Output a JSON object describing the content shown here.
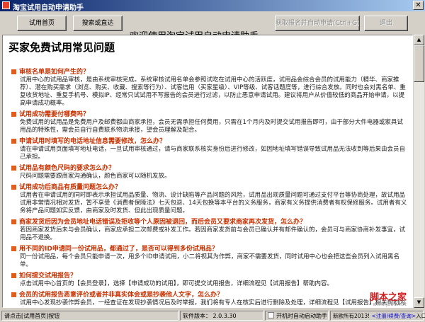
{
  "window": {
    "title": "淘宝试用自动申请助手"
  },
  "toolbar": {
    "home_label": "试用首页",
    "search_label": "搜索或直达",
    "welcome_text": "欢迎使用淘宝试用自动申请助手...",
    "fetch_label": "获取报名并自动申请(Ctrl+G)",
    "exit_label": "退出"
  },
  "content": {
    "title": "买家免费试用常见问题",
    "faq": [
      {
        "q": "审核名单是如何产生的？",
        "a": "试用中心的试用品审核，是由系统审核完成。系统审核试用名单会参照试吃在试用中心的活跃度，试用品会综合会员的试用能力（精华、商家推荐）、潜在购买需求（浏览、购买、收藏、搜索等行为）、试客信用（买家星级）、VIP等级、试客话题度等，进行综合发放。同时也会对黑名单、重复收货地址、重复手机号、模拟IP、经常只试试用不写报告的会员进行过滤，以防止恶意申请试用。建议将用户从价值较低的商品开始申请，以提高申请成功概率。"
      },
      {
        "q": "试用成功需要付哪费吗？",
        "a": "免费试用的试用品是免费用户及邮费都由商家承担，会员无需承担任何费用，只需在1个月内及时提交试用报告即可，由于部分大件电器或家具试用品的特殊性，需会员自行自费联系物流承接，望会员理解及配合。"
      },
      {
        "q": "申请试用时填写的电话地址信息需要修改，怎么办？",
        "a": "请在申请试用页面填写地址电话，一旦试用审核通过，请与商家联系核实身份后进行修改，如因地址填写错误导致试用品无法收到等后果由会员自己承担。"
      },
      {
        "q": "试用品有颜色尺码的要求怎么办？",
        "a": "尺码问题需要跟商家沟通确认，颜色商家可以随机发放。"
      },
      {
        "q": "试用成功后商品有质量问题怎么办？",
        "a": "试用者在申请试用的同时即表示承担试用品质量、物流、设计缺陷等产品问题的风险，试用品出现质量问题可通过支付平台等协商处理，故试用品试用非常情况相对发货，暂不享受《消费者保障法》七天包退、14天包换等本平台的义务服务，商家有义务提供消费者有权保修服务。试用者有义务将产品问题如实反馈，由商家及时发货、但此出现质量问题。"
      },
      {
        "q": "商家发货后因为会员地址电话错误及拒收等个人原因被退回，而后会员又要求商家再次发货，怎么办？",
        "a": "若因商家发货后未与会员确认，商家应承担二次邮费或补发工作。若因商家发货前与会员已确认并有邮件确认的，会员可与商家协商补发事宜，试用品不退换。"
      },
      {
        "q": "用不同的ID申请同一份试用品，都通过了，是否可以得到多份试用品？",
        "a": "同一份试用品，每个会员只能申请一次，用多个ID申请试用，小二将视其为作弊，商家不需要发货，同时试用中心也会把这些会员列入试用黑名单。"
      },
      {
        "q": "如何提交试用报告？",
        "a": "点击试用中心首页的【会员登录】，选择【申请成功的试用】，即可提交试用报告，详细流程见【试用报告】帮助内容。"
      },
      {
        "q": "会员的试用报告恶意评价或者并非真实体会或是抄袭他人文字，怎么办？",
        "a": "试用中心发现抄袭作弊会员，一经查证在发现抄袭情况后及时举报，我们将有专人在核实后进行删除及处理，详细流程见【试用报告】相关帮助内容。"
      },
      {
        "q": "免费试用成功后，商家拒绝发货，我该如何投诉？",
        "a": "在申请成功后一周内，商家有义务主动联系申请成功试客进行发货，如若您未收到联系，请您先去商家主动沟通申请发货。"
      }
    ],
    "watermark": "脚本之家",
    "watermark_sub": "www.jb51.net"
  },
  "status": {
    "hint": "请点击[试用首页]按钮",
    "version_label": "软件版本：",
    "version": "2.0.3.30",
    "autostart_label": "开机时自动启动助手",
    "copyright_text": "新欧所有2013!",
    "link_text": "<注册/续费/查询>",
    "entry_text": "入口"
  },
  "colors": {
    "question": "#c83200",
    "titlebar_start": "#0a246a",
    "watermark": "#d02020"
  }
}
